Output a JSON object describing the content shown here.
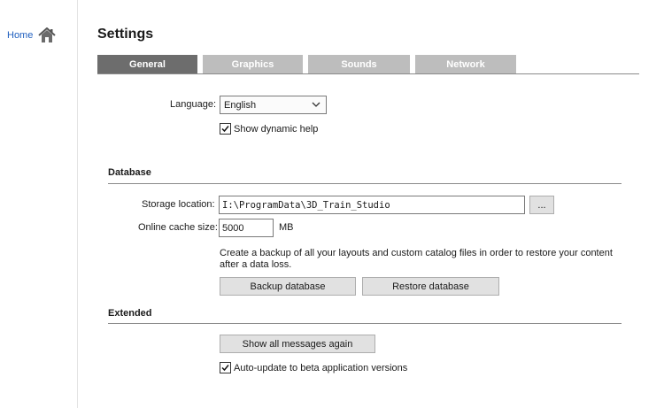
{
  "nav": {
    "home_label": "Home",
    "home_icon": "home-icon"
  },
  "page": {
    "title": "Settings"
  },
  "tabs": [
    {
      "label": "General",
      "active": true
    },
    {
      "label": "Graphics",
      "active": false
    },
    {
      "label": "Sounds",
      "active": false
    },
    {
      "label": "Network",
      "active": false
    }
  ],
  "general": {
    "language_label": "Language:",
    "language_value": "English",
    "dynamic_help_label": "Show dynamic help",
    "dynamic_help_checked": true
  },
  "database": {
    "section_title": "Database",
    "storage_label": "Storage location:",
    "storage_value": "I:\\ProgramData\\3D_Train_Studio",
    "browse_label": "...",
    "cache_label": "Online cache size:",
    "cache_value": "5000",
    "cache_unit": "MB",
    "help_text": "Create a backup of all your layouts and custom catalog files in order to restore your content after a data loss.",
    "backup_label": "Backup database",
    "restore_label": "Restore database"
  },
  "extended": {
    "section_title": "Extended",
    "show_messages_label": "Show all messages again",
    "beta_label": "Auto-update to beta application versions",
    "beta_checked": true
  },
  "colors": {
    "tab_active": "#6d6d6d",
    "tab_inactive": "#bdbdbd",
    "link": "#1f5fbf"
  }
}
